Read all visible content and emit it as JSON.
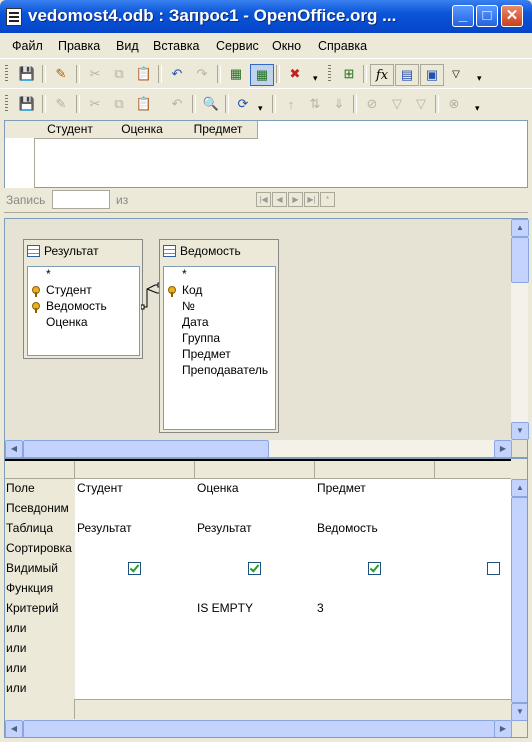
{
  "window": {
    "title": "vedomost4.odb : Запрос1 - OpenOffice.org ..."
  },
  "menu": [
    "Файл",
    "Правка",
    "Вид",
    "Вставка",
    "Сервис",
    "Окно",
    "Справка"
  ],
  "result_grid": {
    "columns": [
      "Студент",
      "Оценка",
      "Предмет"
    ]
  },
  "navigator": {
    "record_label": "Запись",
    "of_label": "из"
  },
  "tables": [
    {
      "name": "Результат",
      "fields": [
        {
          "name": "*",
          "key": false
        },
        {
          "name": "Студент",
          "key": true
        },
        {
          "name": "Ведомость",
          "key": true
        },
        {
          "name": "Оценка",
          "key": false
        }
      ]
    },
    {
      "name": "Ведомость",
      "fields": [
        {
          "name": "*",
          "key": false
        },
        {
          "name": "Код",
          "key": true
        },
        {
          "name": "№",
          "key": false
        },
        {
          "name": "Дата",
          "key": false
        },
        {
          "name": "Группа",
          "key": false
        },
        {
          "name": "Предмет",
          "key": false
        },
        {
          "name": "Преподаватель",
          "key": false
        }
      ]
    }
  ],
  "design_grid": {
    "row_labels": [
      "Поле",
      "Псевдоним",
      "Таблица",
      "Сортировка",
      "Видимый",
      "Функция",
      "Критерий",
      "или",
      "или",
      "или",
      "или"
    ],
    "columns": [
      {
        "field": "Студент",
        "alias": "",
        "table": "Результат",
        "sort": "",
        "visible": true,
        "function": "",
        "criteria": "",
        "or": [
          "",
          "",
          "",
          ""
        ]
      },
      {
        "field": "Оценка",
        "alias": "",
        "table": "Результат",
        "sort": "",
        "visible": true,
        "function": "",
        "criteria": "IS EMPTY",
        "or": [
          "",
          "",
          "",
          ""
        ]
      },
      {
        "field": "Предмет",
        "alias": "",
        "table": "Ведомость",
        "sort": "",
        "visible": true,
        "function": "",
        "criteria": "3",
        "or": [
          "",
          "",
          "",
          ""
        ]
      },
      {
        "field": "",
        "alias": "",
        "table": "",
        "sort": "",
        "visible": false,
        "function": "",
        "criteria": "",
        "or": [
          "",
          "",
          "",
          ""
        ]
      }
    ]
  },
  "toolbar1_icons": [
    "save-icon",
    "edit-mode-icon",
    "cut-icon",
    "copy-icon",
    "paste-icon",
    "undo-icon",
    "redo-icon",
    "design-view-icon",
    "add-table-icon",
    "clear-query-icon",
    "function-icon",
    "field-names-icon",
    "table-names-icon",
    "distinct-values-icon"
  ],
  "toolbar2_icons": [
    "save-record-icon",
    "edit-data-icon",
    "cut-icon",
    "copy-icon",
    "paste-icon",
    "undo-icon",
    "find-icon",
    "refresh-icon",
    "sort-ascending-icon",
    "sort-descending-icon",
    "sort-icon",
    "autofilter-icon",
    "standard-filter-icon",
    "apply-filter-icon",
    "remove-filter-icon"
  ]
}
